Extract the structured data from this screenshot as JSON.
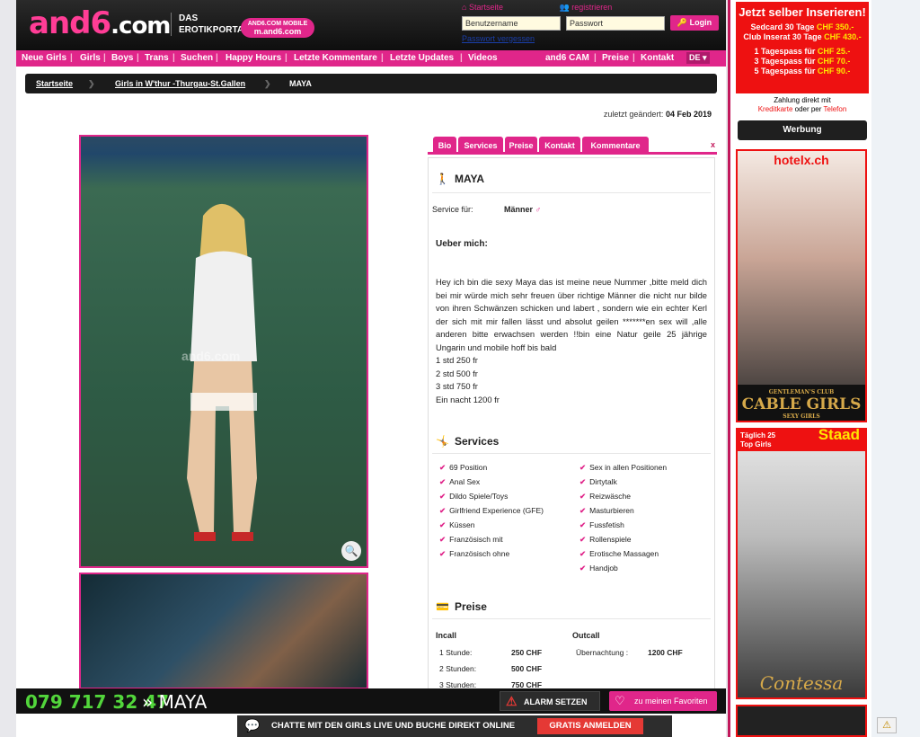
{
  "header": {
    "logo_main": "and6",
    "logo_suffix": ".com",
    "logo_sub1": "DAS",
    "logo_sub2": "EROTIKPORTAL",
    "mobile_badge_top": "AND6.COM MOBILE",
    "mobile_badge_url": "m.and6.com",
    "link_start": "Startseite",
    "link_register": "registrieren",
    "username_placeholder": "Benutzername",
    "password_placeholder": "Passwort",
    "login_label": "Login",
    "forgot_label": "Passwort vergessen"
  },
  "nav": {
    "items": [
      "Neue Girls",
      "Girls",
      "Boys",
      "Trans",
      "Suchen",
      "Happy Hours",
      "Letzte Kommentare",
      "Letzte Updates",
      "Videos",
      "and6 CAM",
      "Preise",
      "Kontakt"
    ],
    "lang": "DE"
  },
  "breadcrumb": [
    "Startseite",
    "Girls in W'thur -Thurgau-St.Gallen",
    "MAYA"
  ],
  "last_changed_label": "zuletzt geändert:",
  "last_changed_date": "04 Feb 2019",
  "photo": {
    "watermark": "and6.com"
  },
  "tabs": [
    "Bio",
    "Services",
    "Preise",
    "Kontakt",
    "Kommentare"
  ],
  "tab_close": "x",
  "profile": {
    "name": "MAYA",
    "service_for_label": "Service für:",
    "service_for_value": "Männer",
    "service_for_symbol": "♂",
    "about_label": "Ueber mich:",
    "bio": "Hey ich bin die sexy Maya das ist meine neue Nummer ,bitte meld dich bei mir würde mich sehr freuen über richtige Männer die nicht nur bilde von ihren Schwänzen schicken und labert , sondern wie ein echter Kerl der sich mit mir fallen lässt und absolut geilen *******en sex will ,alle anderen bitte erwachsen werden !!bin eine Natur geile 25 jährige Ungarin und mobile hoff bis bald\n1 std 250 fr\n2 std 500 fr\n3 std 750 fr\nEin nacht 1200 fr"
  },
  "services": {
    "title": "Services",
    "left": [
      "69 Position",
      "Anal Sex",
      "Dildo Spiele/Toys",
      "Girlfriend Experience (GFE)",
      "Küssen",
      "Französisch mit",
      "Französisch ohne"
    ],
    "right": [
      "Sex in allen Positionen",
      "Dirtytalk",
      "Reizwäsche",
      "Masturbieren",
      "Fussfetish",
      "Rollenspiele",
      "Erotische Massagen",
      "Handjob"
    ]
  },
  "prices": {
    "title": "Preise",
    "incall_label": "Incall",
    "outcall_label": "Outcall",
    "incall": [
      {
        "label": "1 Stunde:",
        "value": "250 CHF"
      },
      {
        "label": "2 Stunden:",
        "value": "500 CHF"
      },
      {
        "label": "3 Stunden:",
        "value": "750 CHF"
      }
    ],
    "outcall": [
      {
        "label": "Übernachtung :",
        "value": "1200 CHF"
      }
    ]
  },
  "sticky": {
    "phone": "079 717 32 47",
    "name": "» MAYA",
    "alarm_label": "ALARM SETZEN",
    "fav_label": "zu meinen Favoriten"
  },
  "chat": {
    "text": "CHATTE MIT DEN GIRLS LIVE UND BUCHE DIREKT ONLINE",
    "cta": "GRATIS ANMELDEN"
  },
  "ads": {
    "ad1_title": "Jetzt selber Inserieren!",
    "ad1_line1_a": "Sedcard 30 Tage ",
    "ad1_line1_b": "CHF 350.-",
    "ad1_line2_a": "Club Inserat 30 Tage ",
    "ad1_line2_b": "CHF 430.-",
    "ad1_line3_a": "1 Tagespass für ",
    "ad1_line3_b": "CHF 25.-",
    "ad1_line4_a": "3 Tagespass für ",
    "ad1_line4_b": "CHF 70.-",
    "ad1_line5_a": "5 Tagespass für ",
    "ad1_line5_b": "CHF 90.-",
    "ad1_foot1": "Zahlung direkt mit",
    "ad1_foot2_a": "Kreditkarte",
    "ad1_foot2_b": " oder per ",
    "ad1_foot2_c": "Telefon",
    "werbung": "Werbung",
    "ad2_brand": "hotelx.ch",
    "ad2_club_top": "GENTLEMAN'S CLUB",
    "ad2_club": "CABLE GIRLS",
    "ad2_club_bottom": "SEXY GIRLS",
    "ad3_line1": "Täglich 25",
    "ad3_line2": "Top Girls",
    "ad3_brand": "Staad",
    "ad3_name": "Contessa"
  }
}
